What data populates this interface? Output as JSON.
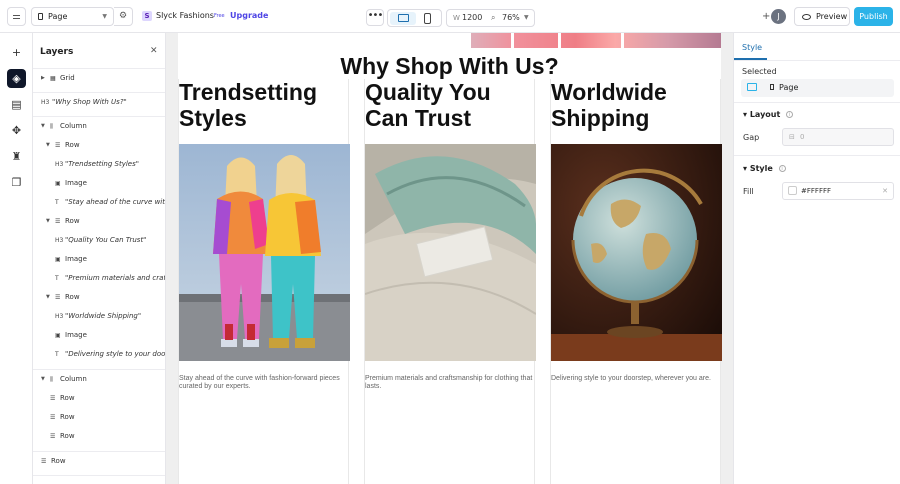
{
  "topbar": {
    "page_label": "Page",
    "site_initial": "S",
    "site_name": "Slyck Fashions",
    "plan_badge": "Free",
    "upgrade_label": "Upgrade",
    "more_label": "•••",
    "width_prefix": "W",
    "width_value": "1200",
    "zoom_value": "76%",
    "avatar_initial": "J",
    "preview_label": "Preview",
    "publish_label": "Publish"
  },
  "layers": {
    "title": "Layers",
    "rows": [
      {
        "label": "Grid"
      },
      {
        "label": "\"Why Shop With Us?\""
      },
      {
        "label": "Column"
      },
      {
        "label": "Row"
      },
      {
        "label": "\"Trendsetting Styles\""
      },
      {
        "label": "Image"
      },
      {
        "label": "\"Stay ahead of the curve with fashion-forward pieces\""
      },
      {
        "label": "Row"
      },
      {
        "label": "\"Quality You Can Trust\""
      },
      {
        "label": "Image"
      },
      {
        "label": "\"Premium materials and craftsmanship\""
      },
      {
        "label": "Row"
      },
      {
        "label": "\"Worldwide Shipping\""
      },
      {
        "label": "Image"
      },
      {
        "label": "\"Delivering style to your doorstep\""
      },
      {
        "label": "Column"
      },
      {
        "label": "Row"
      },
      {
        "label": "Row"
      },
      {
        "label": "Row"
      },
      {
        "label": "Row"
      }
    ]
  },
  "canvas": {
    "section_title": "Why Shop With Us?",
    "columns": [
      {
        "title": "Trendsetting Styles",
        "desc": "Stay ahead of the curve with fashion-forward pieces curated by our experts."
      },
      {
        "title": "Quality You Can Trust",
        "desc": "Premium materials and craftsmanship for clothing that lasts."
      },
      {
        "title": "Worldwide Shipping",
        "desc": "Delivering style to your doorstep, wherever you are."
      }
    ]
  },
  "right_panel": {
    "tab": "Style",
    "selected_label": "Selected",
    "selected_value": "Page",
    "layout_label": "Layout",
    "gap_label": "Gap",
    "gap_placeholder": "0",
    "style_label": "Style",
    "fill_label": "Fill",
    "fill_value": "#FFFFFF"
  },
  "colors": {
    "accent": "#2bb3e8",
    "link": "#1e6fae",
    "upgrade": "#4f46e5"
  }
}
